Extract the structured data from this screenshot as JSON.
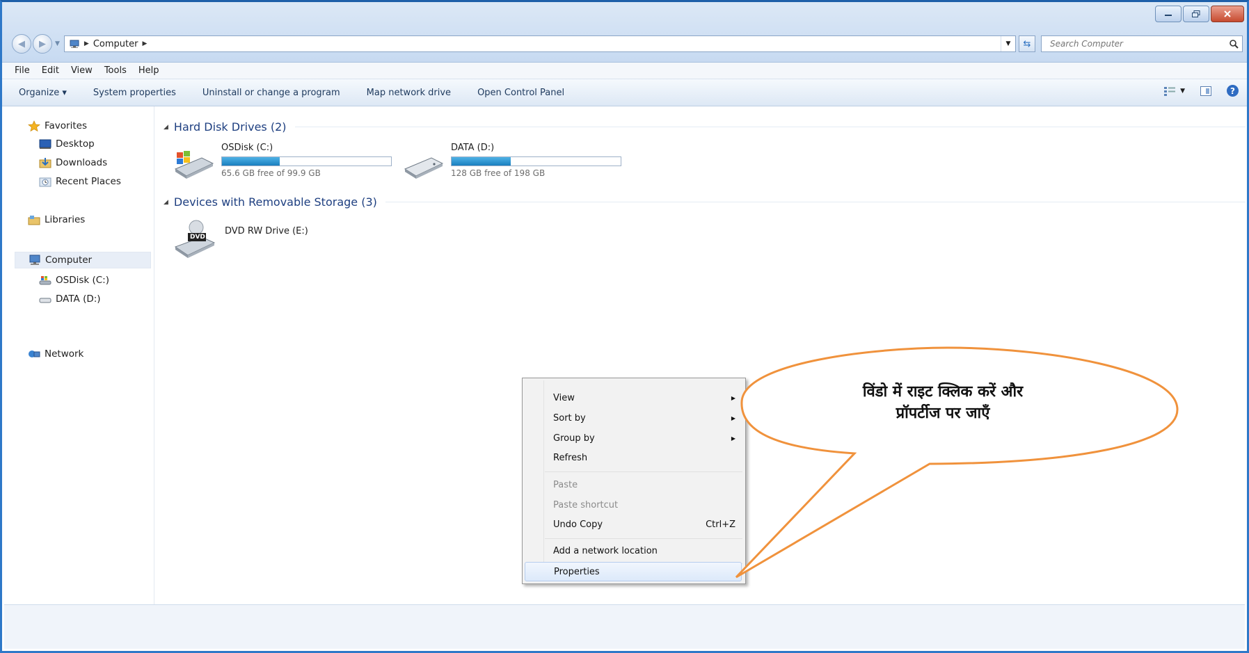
{
  "window": {
    "caption_buttons": [
      "minimize",
      "restore",
      "close"
    ]
  },
  "address_bar": {
    "location": "Computer",
    "search_placeholder": "Search Computer"
  },
  "menu": [
    "File",
    "Edit",
    "View",
    "Tools",
    "Help"
  ],
  "toolbar": {
    "commands": [
      "Organize ▾",
      "System properties",
      "Uninstall or change a program",
      "Map network drive",
      "Open Control Panel"
    ]
  },
  "nav_pane": {
    "favorites": "Favorites",
    "desktop": "Desktop",
    "downloads": "Downloads",
    "recent": "Recent Places",
    "libraries": "Libraries",
    "computer": "Computer",
    "osdisk": "OSDisk (C:)",
    "data": "DATA (D:)",
    "network": "Network"
  },
  "groups": {
    "hard_disks": "Hard Disk Drives (2)",
    "removable": "Devices with Removable Storage (3)"
  },
  "drives": [
    {
      "name": "OSDisk (C:)",
      "free": "65.6 GB free of 99.9 GB",
      "used_fraction": 0.34
    },
    {
      "name": "DATA (D:)",
      "free": "128 GB free of 198 GB",
      "used_fraction": 0.35
    }
  ],
  "removable": {
    "dvd": "DVD RW Drive (E:)",
    "dvd_icon_text": "DVD"
  },
  "context_menu": {
    "view": "View",
    "sort_by": "Sort by",
    "group_by": "Group by",
    "refresh": "Refresh",
    "paste": "Paste",
    "paste_shortcut": "Paste shortcut",
    "undo_copy": "Undo Copy",
    "undo_shortcut": "Ctrl+Z",
    "add_network": "Add a network location",
    "properties": "Properties"
  },
  "callout": {
    "line1": "विंडो में राइट क्लिक करें और",
    "line2": "प्रॉपर्टीज पर जाएँ",
    "color": "#f0923c"
  }
}
